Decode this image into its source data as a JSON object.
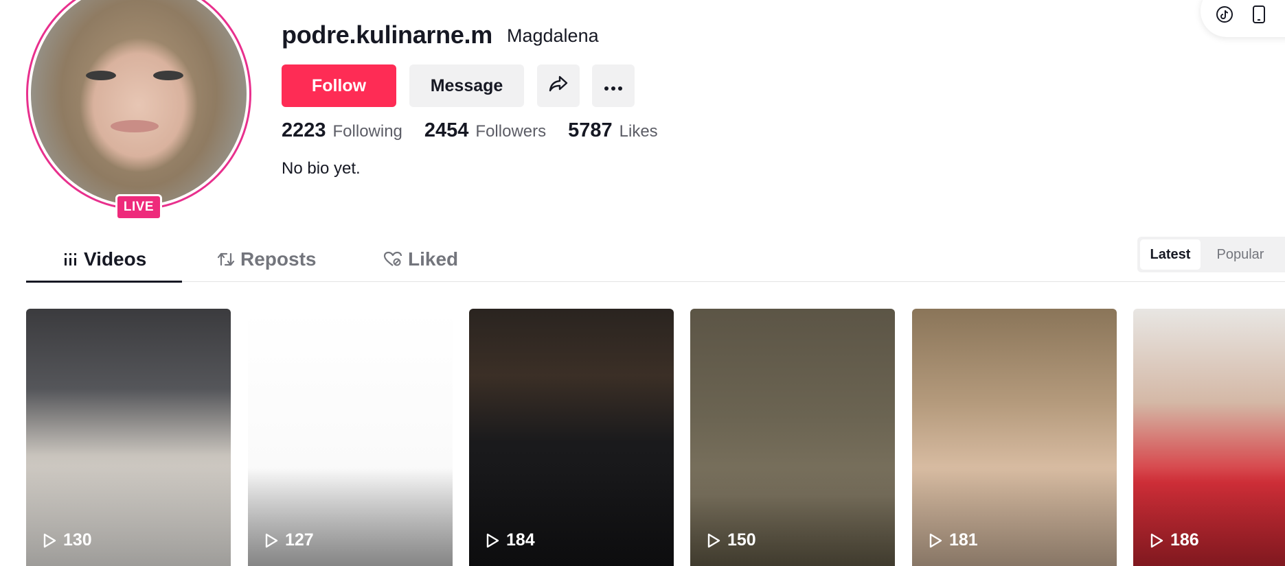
{
  "profile": {
    "username": "podre.kulinarne.m",
    "nickname": "Magdalena",
    "live_badge": "LIVE",
    "bio": "No bio yet."
  },
  "actions": {
    "follow_label": "Follow",
    "message_label": "Message",
    "share_icon": "share-arrow-icon",
    "more_icon": "more-dots-icon"
  },
  "stats": [
    {
      "value": "2223",
      "label": "Following"
    },
    {
      "value": "2454",
      "label": "Followers"
    },
    {
      "value": "5787",
      "label": "Likes"
    }
  ],
  "tabs": [
    {
      "label": "Videos",
      "icon": "grid-icon",
      "active": true
    },
    {
      "label": "Reposts",
      "icon": "repost-icon",
      "active": false
    },
    {
      "label": "Liked",
      "icon": "liked-heart-icon",
      "active": false
    }
  ],
  "sort": {
    "latest_label": "Latest",
    "popular_label": "Popular"
  },
  "videos": [
    {
      "views": "130"
    },
    {
      "views": "127"
    },
    {
      "views": "184"
    },
    {
      "views": "150"
    },
    {
      "views": "181"
    },
    {
      "views": "186"
    }
  ],
  "colors": {
    "follow": "#fe2c55",
    "live": "#ee2a7b",
    "text": "#161823",
    "muted": "#73757c"
  }
}
